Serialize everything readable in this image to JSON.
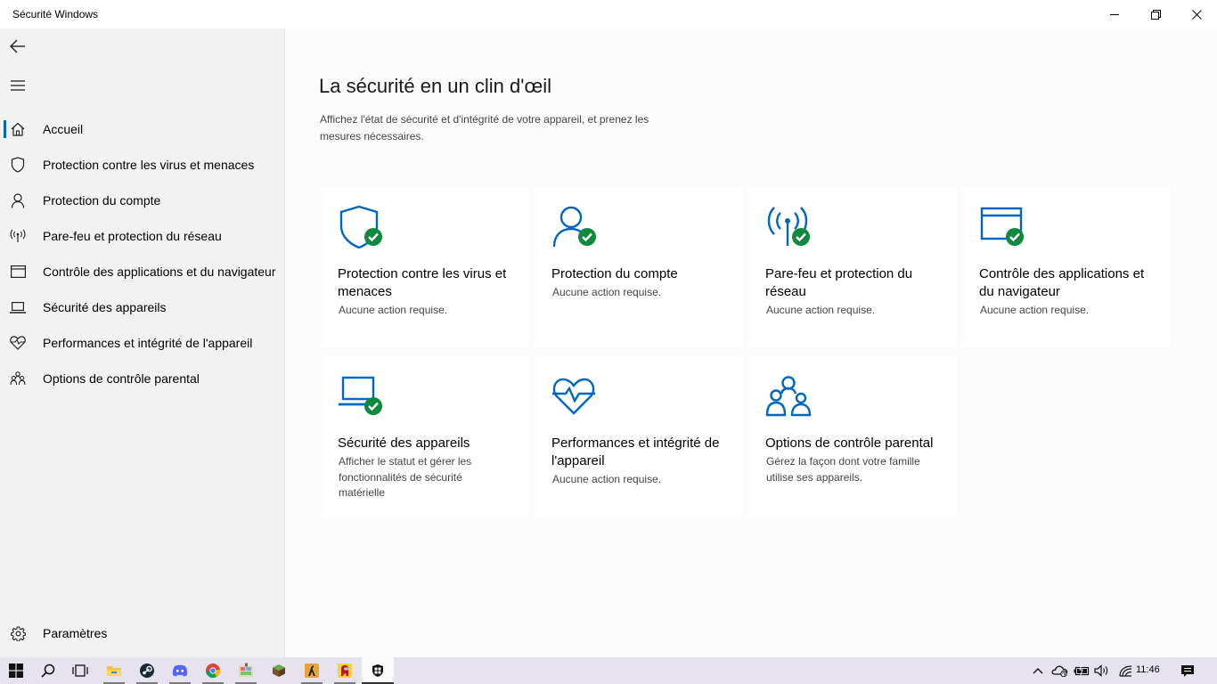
{
  "window": {
    "title": "Sécurité Windows",
    "controls": [
      "minimize-icon",
      "restore-icon",
      "close-icon"
    ]
  },
  "sidebar": {
    "back_icon": "back-arrow-icon",
    "menu_icon": "hamburger-menu-icon",
    "items": [
      {
        "label": "Accueil",
        "icon": "home-icon",
        "active": true
      },
      {
        "label": "Protection contre les virus et menaces",
        "icon": "shield-icon"
      },
      {
        "label": "Protection du compte",
        "icon": "person-icon"
      },
      {
        "label": "Pare-feu et protection du réseau",
        "icon": "antenna-icon"
      },
      {
        "label": "Contrôle des applications et du navigateur",
        "icon": "browser-window-icon"
      },
      {
        "label": "Sécurité des appareils",
        "icon": "laptop-icon"
      },
      {
        "label": "Performances et intégrité de l'appareil",
        "icon": "heart-pulse-icon"
      },
      {
        "label": "Options de contrôle parental",
        "icon": "family-icon"
      }
    ],
    "settings": {
      "label": "Paramètres",
      "icon": "gear-icon"
    }
  },
  "main": {
    "title": "La sécurité en un clin d'œil",
    "description": "Affichez l'état de sécurité et d'intégrité de votre appareil, et prenez les mesures nécessaires.",
    "tiles": [
      {
        "title": "Protection contre les virus et menaces",
        "status": "Aucune action requise.",
        "icon": "shield-icon",
        "ok": true
      },
      {
        "title": "Protection du compte",
        "status": "Aucune action requise.",
        "icon": "person-icon",
        "ok": true
      },
      {
        "title": "Pare-feu et protection du réseau",
        "status": "Aucune action requise.",
        "icon": "antenna-icon",
        "ok": true
      },
      {
        "title": "Contrôle des applications et du navigateur",
        "status": "Aucune action requise.",
        "icon": "browser-window-icon",
        "ok": true
      },
      {
        "title": "Sécurité des appareils",
        "status": "Afficher le statut et gérer les fonctionnalités de sécurité matérielle",
        "icon": "laptop-icon",
        "ok": true
      },
      {
        "title": "Performances et intégrité de l'appareil",
        "status": "Aucune action requise.",
        "icon": "heart-pulse-icon",
        "ok": false
      },
      {
        "title": "Options de contrôle parental",
        "status": "Gérez la façon dont votre famille utilise ses appareils.",
        "icon": "family-icon",
        "ok": false
      }
    ]
  },
  "taskbar": {
    "apps": [
      "windows-start-icon",
      "search-icon",
      "task-view-icon",
      "file-explorer-icon",
      "steam-icon",
      "discord-icon",
      "chrome-icon",
      "paint-app-icon",
      "minecraft-icon",
      "counter-strike-icon",
      "among-us-icon",
      "windows-security-icon"
    ],
    "tray": [
      "chevron-up-icon",
      "onedrive-icon",
      "battery-icon",
      "volume-icon",
      "wifi-icon",
      "notification-icon"
    ],
    "clock": "11:46"
  },
  "colors": {
    "accent": "#0067c0",
    "ok_green": "#10893e",
    "sidebar_bg": "#f2f2f2",
    "main_bg": "#fbfbfb",
    "taskbar_bg": "#e6e3ee"
  }
}
